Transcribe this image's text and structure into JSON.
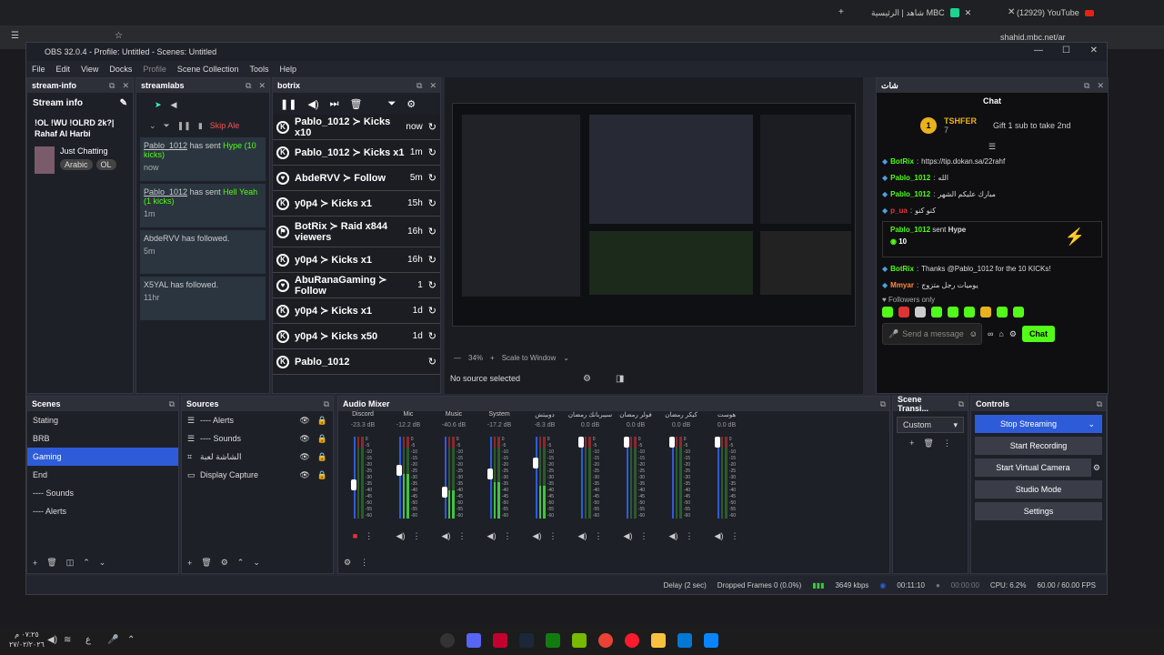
{
  "browser": {
    "tabs": [
      {
        "title": "شاهد | الرئيسية MBC",
        "icon": "shahid-icon"
      },
      {
        "title": "(12929) YouTube",
        "icon": "youtube-icon"
      }
    ],
    "url": "shahid.mbc.net/ar"
  },
  "obs": {
    "title": "OBS 32.0.4 - Profile: Untitled - Scenes: Untitled",
    "menu": [
      "File",
      "Edit",
      "View",
      "Docks",
      "Profile",
      "Scene Collection",
      "Tools",
      "Help"
    ],
    "stream_info": {
      "header": "stream-info",
      "label": "Stream info",
      "title": "!OL !WU !OLRD 2k?| Rahaf Al Harbi",
      "category": "Just Chatting",
      "tags": [
        "Arabic",
        "OL"
      ]
    },
    "streamlabs": {
      "header": "streamlabs",
      "skip_label": "Skip Ale",
      "items": [
        {
          "user": "Pablo_1012",
          "text": "has sent",
          "gift": "Hype (10 kicks)",
          "time": "now"
        },
        {
          "user": "Pablo_1012",
          "text": "has sent",
          "gift": "Hell Yeah (1 kicks)",
          "time": "1m"
        },
        {
          "user": "AbdeRVV",
          "text": "has followed.",
          "gift": "",
          "time": "5m"
        },
        {
          "user": "X5YAL",
          "text": "has followed.",
          "gift": "",
          "time": "11hr"
        }
      ]
    },
    "botrix": {
      "header": "botrix",
      "rows": [
        {
          "text": "Pablo_1012 ≻ Kicks x10",
          "time": "now",
          "icon": "kick-icon"
        },
        {
          "text": "Pablo_1012 ≻ Kicks x1",
          "time": "1m",
          "icon": "kick-icon"
        },
        {
          "text": "AbdeRVV ≻ Follow",
          "time": "5m",
          "icon": "heart-icon"
        },
        {
          "text": "y0p4 ≻ Kicks x1",
          "time": "15h",
          "icon": "kick-icon"
        },
        {
          "text": "BotRix ≻ Raid x844 viewers",
          "time": "16h",
          "icon": "raid-icon"
        },
        {
          "text": "y0p4 ≻ Kicks x1",
          "time": "16h",
          "icon": "kick-icon"
        },
        {
          "text": "AbuRanaGaming ≻ Follow",
          "time": "1",
          "icon": "heart-icon"
        },
        {
          "text": "y0p4 ≻ Kicks x1",
          "time": "1d",
          "icon": "kick-icon"
        },
        {
          "text": "y0p4 ≻ Kicks x50",
          "time": "1d",
          "icon": "kick-icon"
        },
        {
          "text": "Pablo_1012",
          "time": "",
          "icon": "kick-icon"
        }
      ]
    },
    "preview": {
      "zoom": "34%",
      "scale": "Scale to Window",
      "no_source": "No source selected"
    },
    "chat": {
      "header": "شات",
      "title": "Chat",
      "top_gifter": "TSHFER",
      "top_gifter_rank": "1",
      "top_gifter_amount": "7",
      "gift_cta": "Gift 1 sub to take 2nd",
      "messages": [
        {
          "user": "BotRix",
          "text": "https://tip.dokan.sa/22rahf"
        },
        {
          "user": "Pablo_1012",
          "text": "الله"
        },
        {
          "user": "Pablo_1012",
          "text": "مبارك عليكم الشهر"
        },
        {
          "user": "p_ua",
          "text": "كنو كنو"
        }
      ],
      "gift_card": {
        "user": "Pablo_1012",
        "action": "sent",
        "item": "Hype",
        "amount": "10"
      },
      "messages2": [
        {
          "user": "BotRix",
          "text": "Thanks @Pablo_1012 for the 10 KICKs!"
        },
        {
          "user": "Mmyar",
          "text": "يوميات رجل متزوج"
        }
      ],
      "followers_only": "Followers only",
      "input_placeholder": "Send a message",
      "send_label": "Chat"
    },
    "scenes": {
      "header": "Scenes",
      "items": [
        "Stating",
        "BRB",
        "Gaming",
        "End",
        "---- Sounds",
        "---- Alerts"
      ],
      "selected": "Gaming"
    },
    "sources": {
      "header": "Sources",
      "items": [
        {
          "name": "---- Alerts",
          "icon": "list-icon"
        },
        {
          "name": "---- Sounds",
          "icon": "list-icon"
        },
        {
          "name": "الشاشة لعبة",
          "icon": "gamepad-icon"
        },
        {
          "name": "Display Capture",
          "icon": "monitor-icon"
        }
      ]
    },
    "mixer": {
      "header": "Audio Mixer",
      "channels": [
        {
          "name": "Discord",
          "db": "-23.3 dB",
          "level": 0.0,
          "fader": 0.4,
          "muted": true
        },
        {
          "name": "Mic",
          "db": "-12.2 dB",
          "level": 0.55,
          "fader": 0.6,
          "muted": false
        },
        {
          "name": "Music",
          "db": "-40.6 dB",
          "level": 0.35,
          "fader": 0.3,
          "muted": false
        },
        {
          "name": "System",
          "db": "-17.2 dB",
          "level": 0.45,
          "fader": 0.55,
          "muted": false
        },
        {
          "name": "دوبيتش",
          "db": "-8.3 dB",
          "level": 0.4,
          "fader": 0.7,
          "muted": false
        },
        {
          "name": "سيبربانك رمضان",
          "db": "0.0 dB",
          "level": 0.0,
          "fader": 1.0,
          "muted": false
        },
        {
          "name": "فولر رمضان",
          "db": "0.0 dB",
          "level": 0.0,
          "fader": 1.0,
          "muted": false
        },
        {
          "name": "كيكر رمضان",
          "db": "0.0 dB",
          "level": 0.0,
          "fader": 1.0,
          "muted": false
        },
        {
          "name": "هوست",
          "db": "0.0 dB",
          "level": 0.0,
          "fader": 1.0,
          "muted": false
        }
      ],
      "scale": [
        "0",
        "-5",
        "-10",
        "-15",
        "-20",
        "-25",
        "-30",
        "-35",
        "-40",
        "-45",
        "-50",
        "-55",
        "-60"
      ]
    },
    "transitions": {
      "header": "Scene Transi...",
      "value": "Custom"
    },
    "controls": {
      "header": "Controls",
      "stop_streaming": "Stop Streaming",
      "start_recording": "Start Recording",
      "start_virtual_camera": "Start Virtual Camera",
      "studio_mode": "Studio Mode",
      "settings": "Settings"
    },
    "status": {
      "delay": "Delay (2 sec)",
      "dropped": "Dropped Frames 0 (0.0%)",
      "kbps": "3649 kbps",
      "stream_time": "00:11:10",
      "rec_time": "00:00:00",
      "cpu": "CPU: 6.2%",
      "fps": "60.00 / 60.00 FPS"
    }
  },
  "taskbar": {
    "time": "٠٧:٢٥ م",
    "date": "٢٧/٠٢/٢٠٢٦",
    "lang": "ع"
  },
  "colors": {
    "kick_green": "#53fc18",
    "obs_blue": "#2e5bd8",
    "bg": "#1e2028"
  }
}
